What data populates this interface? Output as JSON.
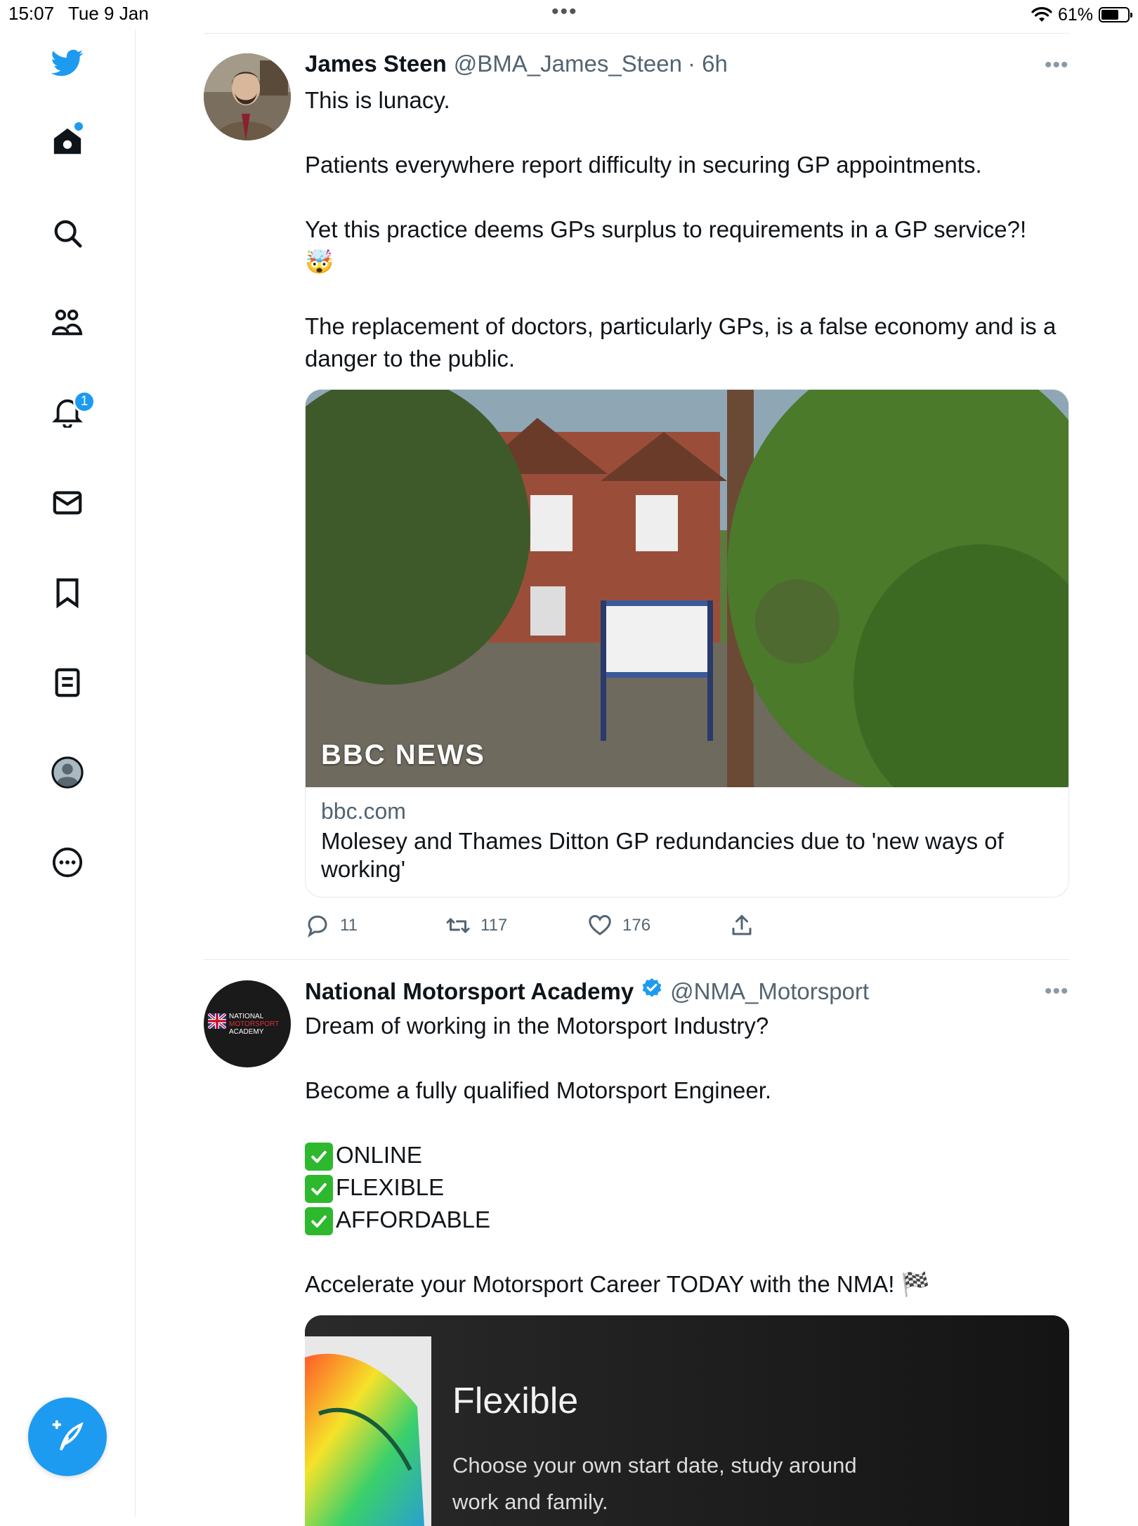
{
  "status_bar": {
    "time": "15:07",
    "date": "Tue 9 Jan",
    "battery": "61%"
  },
  "sidebar": {
    "icons": [
      "twitter-logo-icon",
      "home-icon",
      "search-icon",
      "communities-icon",
      "notifications-icon",
      "messages-icon",
      "bookmarks-icon",
      "lists-icon",
      "profile-icon",
      "more-icon"
    ],
    "notifications_badge": "1",
    "accent": "#1d9bf0"
  },
  "tweets": [
    {
      "name": "James Steen",
      "handle": "@BMA_James_Steen",
      "time": "· 6h",
      "lines": [
        "This is lunacy.",
        "Patients everywhere report difficulty in securing GP appointments.",
        "Yet this practice deems GPs surplus to requirements in a GP service?!",
        "🤯",
        "The replacement of doctors, particularly GPs, is a false economy and is a danger to the public."
      ],
      "card": {
        "watermark": "BBC NEWS",
        "domain": "bbc.com",
        "title": "Molesey and Thames Ditton GP redundancies due to 'new ways of working'"
      },
      "actions": {
        "replies": "11",
        "retweets": "117",
        "likes": "176"
      }
    },
    {
      "name": "National Motorsport Academy",
      "handle": "@NMA_Motorsport",
      "avatar_text": [
        "NATIONAL",
        "MOTORSPORT",
        "ACADEMY"
      ],
      "lines": [
        "Dream of working in the Motorsport Industry?",
        "Become a fully qualified Motorsport Engineer.",
        "ONLINE",
        "FLEXIBLE",
        "AFFORDABLE",
        "Accelerate your Motorsport Career TODAY with the NMA! 🏁"
      ],
      "media": {
        "heading": "Flexible",
        "body_line1": "Choose your own start date, study around",
        "body_line2": "work and family."
      }
    }
  ]
}
